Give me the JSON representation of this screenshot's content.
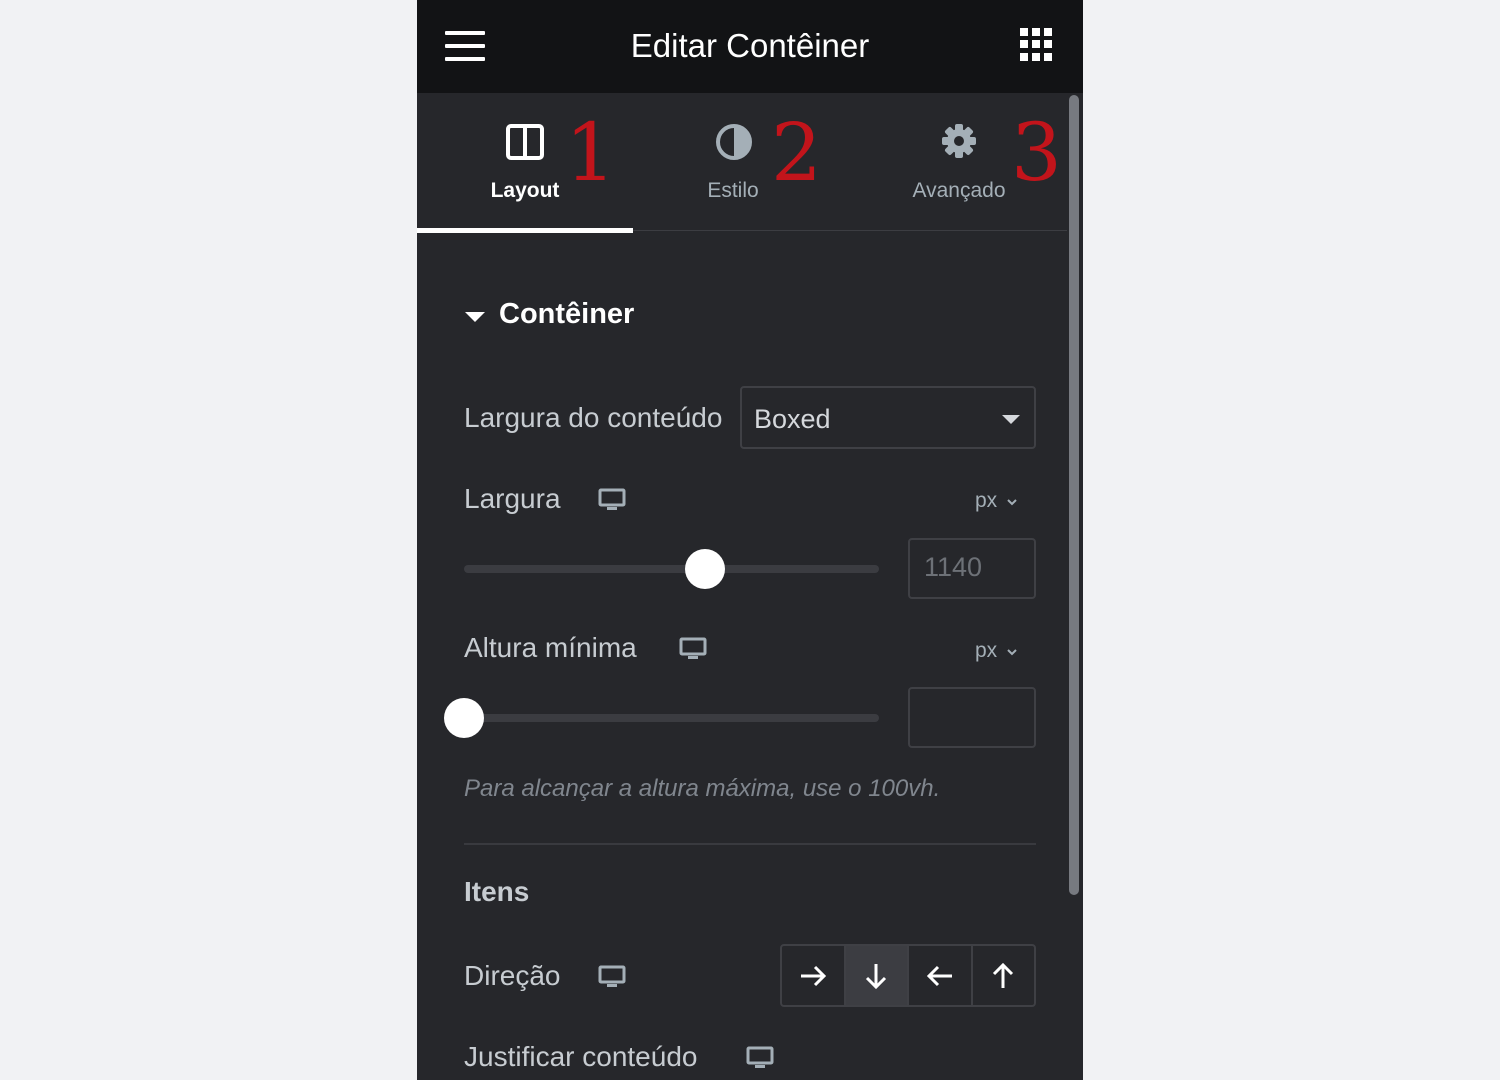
{
  "header": {
    "title": "Editar Contêiner",
    "menu_icon": "hamburger-menu-icon",
    "apps_icon": "grid-apps-icon"
  },
  "tabs": [
    {
      "label": "Layout",
      "icon": "columns-icon",
      "active": true,
      "number": "1"
    },
    {
      "label": "Estilo",
      "icon": "half-circle-icon",
      "active": false,
      "number": "2"
    },
    {
      "label": "Avançado",
      "icon": "gear-icon",
      "active": false,
      "number": "3"
    }
  ],
  "section": {
    "title": "Contêiner",
    "content_width": {
      "label": "Largura do conteúdo",
      "value": "Boxed"
    },
    "width": {
      "label": "Largura",
      "unit": "px",
      "value": "1140",
      "slider_fraction": 0.58
    },
    "min_height": {
      "label": "Altura mínima",
      "unit": "px",
      "value": "",
      "slider_fraction": 0.0
    },
    "hint": "Para alcançar a altura máxima, use o 100vh.",
    "items_heading": "Itens",
    "direction": {
      "label": "Direção",
      "options": [
        "arrow-right-icon",
        "arrow-down-icon",
        "arrow-left-icon",
        "arrow-up-icon"
      ],
      "selected": "arrow-down-icon"
    },
    "justify": {
      "label": "Justificar conteúdo"
    }
  },
  "colors": {
    "panel_bg": "#26272b",
    "header_bg": "#121315",
    "annotation_red": "#c2141b",
    "page_bg": "#f1f2f4"
  }
}
